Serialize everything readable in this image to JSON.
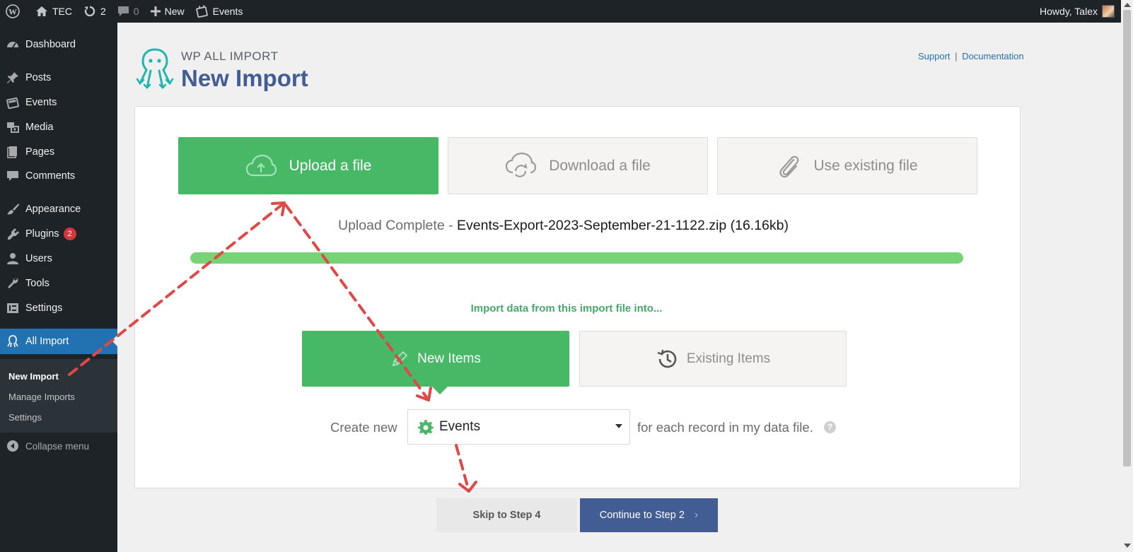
{
  "admin_bar": {
    "site_name": "TEC",
    "updates_count": "2",
    "comments_count": "0",
    "new_label": "New",
    "events_label": "Events",
    "howdy": "Howdy, Talex"
  },
  "sidebar": {
    "items": [
      {
        "label": "Dashboard",
        "icon": "dashboard-icon"
      },
      {
        "label": "Posts",
        "icon": "pin-icon"
      },
      {
        "label": "Events",
        "icon": "calendar-icon"
      },
      {
        "label": "Media",
        "icon": "media-icon"
      },
      {
        "label": "Pages",
        "icon": "pages-icon"
      },
      {
        "label": "Comments",
        "icon": "comment-icon"
      },
      {
        "label": "Appearance",
        "icon": "brush-icon"
      },
      {
        "label": "Plugins",
        "icon": "plugin-icon",
        "badge": "2"
      },
      {
        "label": "Users",
        "icon": "user-icon"
      },
      {
        "label": "Tools",
        "icon": "wrench-icon"
      },
      {
        "label": "Settings",
        "icon": "settings-icon"
      },
      {
        "label": "All Import",
        "icon": "octopus-icon"
      }
    ],
    "submenu": [
      "New Import",
      "Manage Imports",
      "Settings"
    ],
    "collapse_label": "Collapse menu"
  },
  "header": {
    "brand": "WP ALL IMPORT",
    "title": "New Import",
    "support_link": "Support",
    "separator": "|",
    "documentation_link": "Documentation"
  },
  "source_tabs": {
    "upload": "Upload a file",
    "download": "Download a file",
    "existing": "Use existing file"
  },
  "upload_status": {
    "label": "Upload Complete",
    "dash": " - ",
    "file": "Events-Export-2023-September-21-1122.zip (16.16kb)",
    "progress_percent": 100
  },
  "import_into": {
    "heading": "Import data from this import file into...",
    "new_items": "New Items",
    "existing_items": "Existing Items"
  },
  "create_row": {
    "prefix": "Create new",
    "selected_post_type": "Events",
    "suffix": "for each record in my data file.",
    "help": "?"
  },
  "actions": {
    "skip": "Skip to Step 4",
    "continue": "Continue to Step 2",
    "continue_chevron": "›"
  },
  "colors": {
    "green": "#46b866",
    "progress": "#78d376",
    "primary_blue": "#425d94",
    "wp_admin_dark": "#1d2327",
    "wp_highlight": "#2271b1",
    "annotation_red": "#e04848"
  }
}
